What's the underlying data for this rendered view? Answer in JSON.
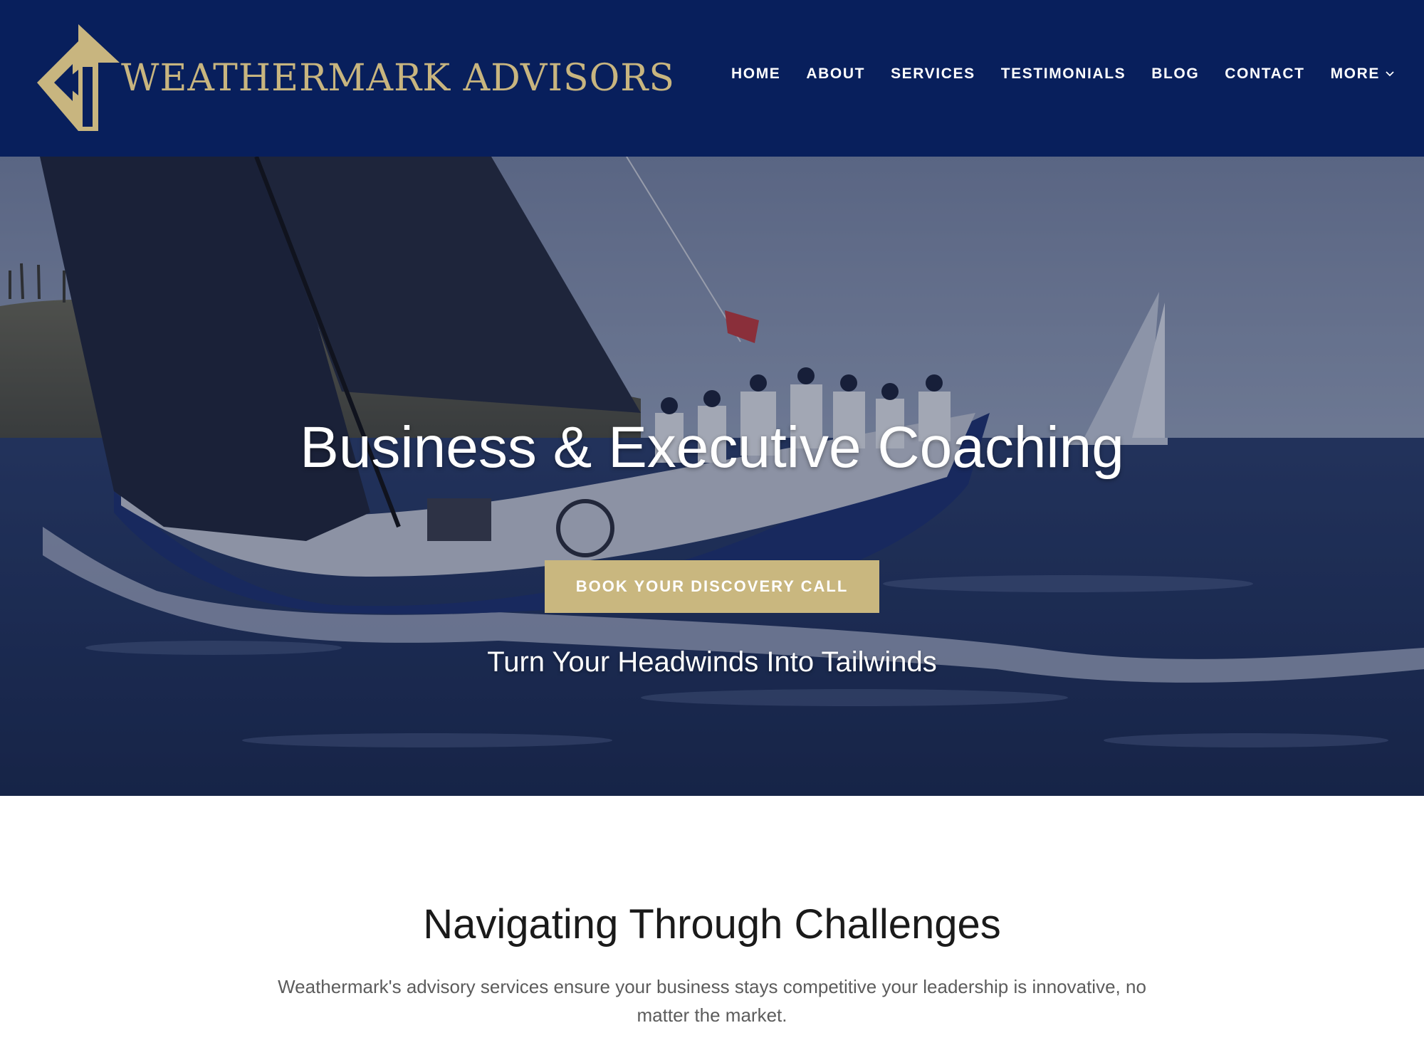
{
  "brand": {
    "name": "WEATHERMARK ADVISORS",
    "logo_icon": "compass-arrow-logo-icon",
    "colors": {
      "navy": "#081f5c",
      "gold": "#c9b77f",
      "white": "#ffffff"
    }
  },
  "nav": {
    "items": [
      {
        "label": "HOME"
      },
      {
        "label": "ABOUT"
      },
      {
        "label": "SERVICES"
      },
      {
        "label": "TESTIMONIALS"
      },
      {
        "label": "BLOG"
      },
      {
        "label": "CONTACT"
      },
      {
        "label": "MORE",
        "icon": "chevron-down-icon"
      }
    ]
  },
  "hero": {
    "image": "sailboat-racing-photo",
    "title": "Business & Executive Coaching",
    "cta_label": "BOOK YOUR DISCOVERY CALL",
    "tagline": "Turn Your Headwinds Into Tailwinds"
  },
  "section": {
    "title": "Navigating Through Challenges",
    "body": "Weathermark's advisory services ensure your business stays competitive your leadership is innovative, no matter the market."
  }
}
